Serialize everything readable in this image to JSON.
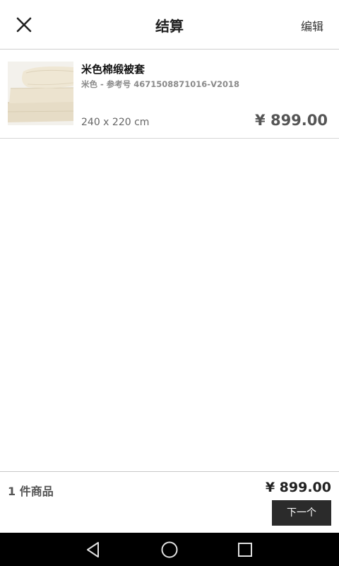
{
  "header": {
    "title": "结算",
    "edit_label": "编辑"
  },
  "cart": {
    "items": [
      {
        "name": "米色棉缎被套",
        "ref": "米色 - 参考号 4671508871016-V2018",
        "size": "240 x 220 cm",
        "price": "¥ 899.00"
      }
    ]
  },
  "summary": {
    "count": "1 件商品",
    "total": "¥ 899.00",
    "next_label": "下一个"
  },
  "icons": {
    "close": "close-icon",
    "back": "back-triangle-icon",
    "home": "home-circle-icon",
    "recent": "recent-apps-square-icon"
  },
  "colors": {
    "button_bg": "#2b2b2b",
    "navbar_bg": "#000000",
    "thumb_bg": "#f3f1ec"
  }
}
